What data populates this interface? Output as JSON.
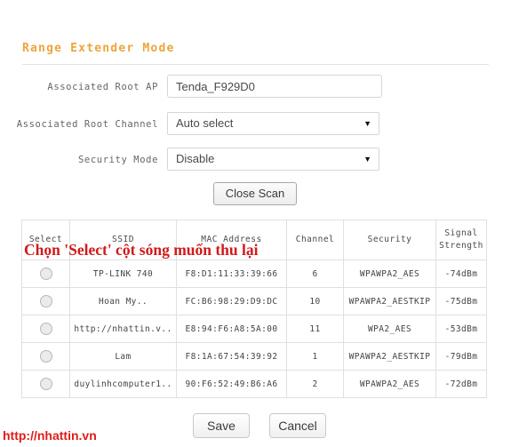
{
  "section": {
    "title": "Range Extender Mode"
  },
  "form": {
    "root_ap": {
      "label": "Associated Root AP",
      "value": "Tenda_F929D0",
      "placeholder": ""
    },
    "root_channel": {
      "label": "Associated Root Channel",
      "value": "Auto select",
      "arrow": "▼"
    },
    "security_mode": {
      "label": "Security Mode",
      "value": "Disable",
      "arrow": "▼"
    },
    "close_scan_label": "Close Scan"
  },
  "overlay_note": "Chọn 'Select' cột sóng muốn thu lại",
  "table": {
    "columns": [
      "Select",
      "SSID",
      "MAC Address",
      "Channel",
      "Security",
      "Signal Strength"
    ],
    "rows": [
      {
        "select": "",
        "ssid": "TP-LINK  740",
        "mac": "F8:D1:11:33:39:66",
        "channel": "6",
        "security": "WPAWPA2_AES",
        "signal": "-74dBm"
      },
      {
        "select": "",
        "ssid": "Hoan  My..",
        "mac": "FC:B6:98:29:D9:DC",
        "channel": "10",
        "security": "WPAWPA2_AESTKIP",
        "signal": "-75dBm"
      },
      {
        "select": "",
        "ssid": "http://nhattin.v..",
        "mac": "E8:94:F6:A8:5A:00",
        "channel": "11",
        "security": "WPA2_AES",
        "signal": "-53dBm"
      },
      {
        "select": "",
        "ssid": "Lam",
        "mac": "F8:1A:67:54:39:92",
        "channel": "1",
        "security": "WPAWPA2_AESTKIP",
        "signal": "-79dBm"
      },
      {
        "select": "",
        "ssid": "duylinhcomputer1..",
        "mac": "90:F6:52:49:B6:A6",
        "channel": "2",
        "security": "WPAWPA2_AES",
        "signal": "-72dBm"
      }
    ]
  },
  "footer": {
    "save_label": "Save",
    "cancel_label": "Cancel"
  },
  "watermark": "http://nhattin.vn",
  "colors": {
    "title_orange": "#eda53c",
    "note_red": "#d11a1a",
    "watermark_red": "#e01b18",
    "border_gray": "#e0e0e0"
  }
}
